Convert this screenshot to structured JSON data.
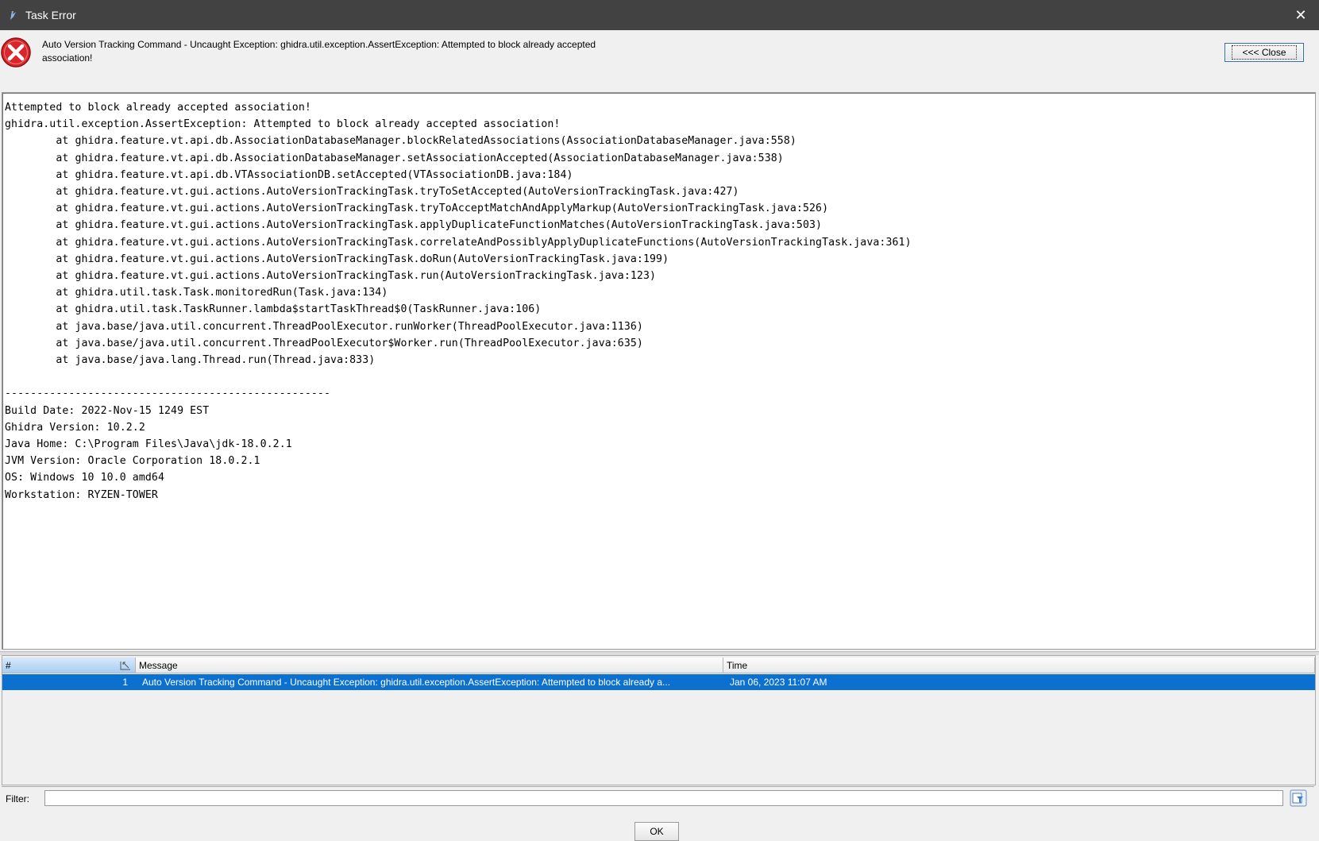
{
  "window": {
    "title": "Task Error",
    "close_glyph": "✕",
    "icon": "ghidra-dragon-icon"
  },
  "header": {
    "icon": "error-icon",
    "message": "Auto Version Tracking Command - Uncaught Exception: ghidra.util.exception.AssertException: Attempted to block already accepted association!",
    "close_button_label": "<<< Close"
  },
  "trace_text": "Attempted to block already accepted association!\nghidra.util.exception.AssertException: Attempted to block already accepted association!\n\tat ghidra.feature.vt.api.db.AssociationDatabaseManager.blockRelatedAssociations(AssociationDatabaseManager.java:558)\n\tat ghidra.feature.vt.api.db.AssociationDatabaseManager.setAssociationAccepted(AssociationDatabaseManager.java:538)\n\tat ghidra.feature.vt.api.db.VTAssociationDB.setAccepted(VTAssociationDB.java:184)\n\tat ghidra.feature.vt.gui.actions.AutoVersionTrackingTask.tryToSetAccepted(AutoVersionTrackingTask.java:427)\n\tat ghidra.feature.vt.gui.actions.AutoVersionTrackingTask.tryToAcceptMatchAndApplyMarkup(AutoVersionTrackingTask.java:526)\n\tat ghidra.feature.vt.gui.actions.AutoVersionTrackingTask.applyDuplicateFunctionMatches(AutoVersionTrackingTask.java:503)\n\tat ghidra.feature.vt.gui.actions.AutoVersionTrackingTask.correlateAndPossiblyApplyDuplicateFunctions(AutoVersionTrackingTask.java:361)\n\tat ghidra.feature.vt.gui.actions.AutoVersionTrackingTask.doRun(AutoVersionTrackingTask.java:199)\n\tat ghidra.feature.vt.gui.actions.AutoVersionTrackingTask.run(AutoVersionTrackingTask.java:123)\n\tat ghidra.util.task.Task.monitoredRun(Task.java:134)\n\tat ghidra.util.task.TaskRunner.lambda$startTaskThread$0(TaskRunner.java:106)\n\tat java.base/java.util.concurrent.ThreadPoolExecutor.runWorker(ThreadPoolExecutor.java:1136)\n\tat java.base/java.util.concurrent.ThreadPoolExecutor$Worker.run(ThreadPoolExecutor.java:635)\n\tat java.base/java.lang.Thread.run(Thread.java:833)\n\n---------------------------------------------------\nBuild Date: 2022-Nov-15 1249 EST\nGhidra Version: 10.2.2\nJava Home: C:\\Program Files\\Java\\jdk-18.0.2.1\nJVM Version: Oracle Corporation 18.0.2.1\nOS: Windows 10 10.0 amd64\nWorkstation: RYZEN-TOWER",
  "table": {
    "columns": [
      "#",
      "Message",
      "Time"
    ],
    "sort_icon": "sort-column-icon",
    "rows": [
      {
        "num": "1",
        "message": "Auto Version Tracking Command - Uncaught Exception: ghidra.util.exception.AssertException: Attempted to block already a...",
        "time": "Jan 06, 2023 11:07 AM",
        "selected": true
      }
    ]
  },
  "filter": {
    "label": "Filter:",
    "value": "",
    "icon": "filter-options-icon"
  },
  "ok_button_label": "OK",
  "colors": {
    "titlebar": "#424242",
    "selection": "#0c70d0",
    "error_red": "#d9262c"
  }
}
